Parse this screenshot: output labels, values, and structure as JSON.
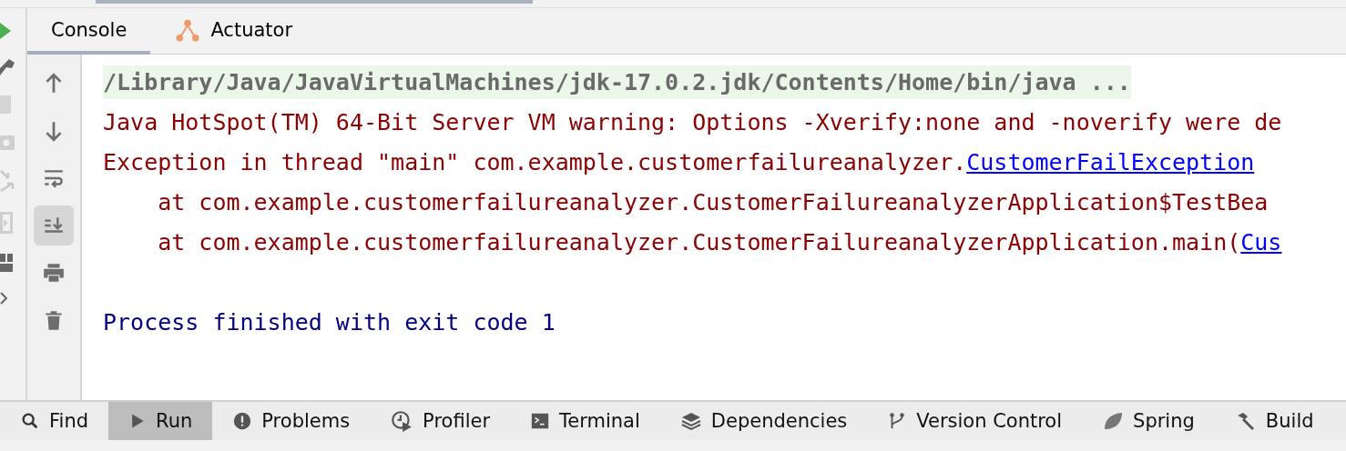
{
  "tabs": [
    {
      "label": "Console",
      "selected": true
    },
    {
      "label": "Actuator",
      "selected": false
    }
  ],
  "toolbar": [
    {
      "selected": false
    },
    {
      "selected": false
    },
    {
      "selected": false
    },
    {
      "selected": true
    },
    {
      "selected": false
    },
    {
      "selected": false
    }
  ],
  "console": {
    "lines": [
      {
        "kind": "command",
        "segments": [
          {
            "kind": "text",
            "text": "/Library/Java/JavaVirtualMachines/jdk-17.0.2.jdk/Contents/Home/bin/java ..."
          }
        ]
      },
      {
        "kind": "error",
        "segments": [
          {
            "kind": "text",
            "text": "Java HotSpot(TM) 64-Bit Server VM warning: Options -Xverify:none and -noverify were de"
          }
        ]
      },
      {
        "kind": "error",
        "segments": [
          {
            "kind": "text",
            "text": "Exception in thread \"main\" com.example.customerfailureanalyzer."
          },
          {
            "kind": "link",
            "text": "CustomerFailException"
          }
        ]
      },
      {
        "kind": "error",
        "segments": [
          {
            "kind": "text",
            "text": "    at com.example.customerfailureanalyzer.CustomerFailureanalyzerApplication$TestBea"
          }
        ]
      },
      {
        "kind": "error",
        "segments": [
          {
            "kind": "text",
            "text": "    at com.example.customerfailureanalyzer.CustomerFailureanalyzerApplication.main("
          },
          {
            "kind": "link",
            "text": "Cus"
          }
        ]
      },
      {
        "kind": "blank"
      },
      {
        "kind": "info",
        "segments": [
          {
            "kind": "text",
            "text": "Process finished with exit code 1"
          }
        ]
      }
    ]
  },
  "tool_windows": [
    {
      "label": "Find",
      "selected": false
    },
    {
      "label": "Run",
      "selected": true
    },
    {
      "label": "Problems",
      "selected": false
    },
    {
      "label": "Profiler",
      "selected": false
    },
    {
      "label": "Terminal",
      "selected": false
    },
    {
      "label": "Dependencies",
      "selected": false
    },
    {
      "label": "Version Control",
      "selected": false
    },
    {
      "label": "Spring",
      "selected": false
    },
    {
      "label": "Build",
      "selected": false
    }
  ]
}
